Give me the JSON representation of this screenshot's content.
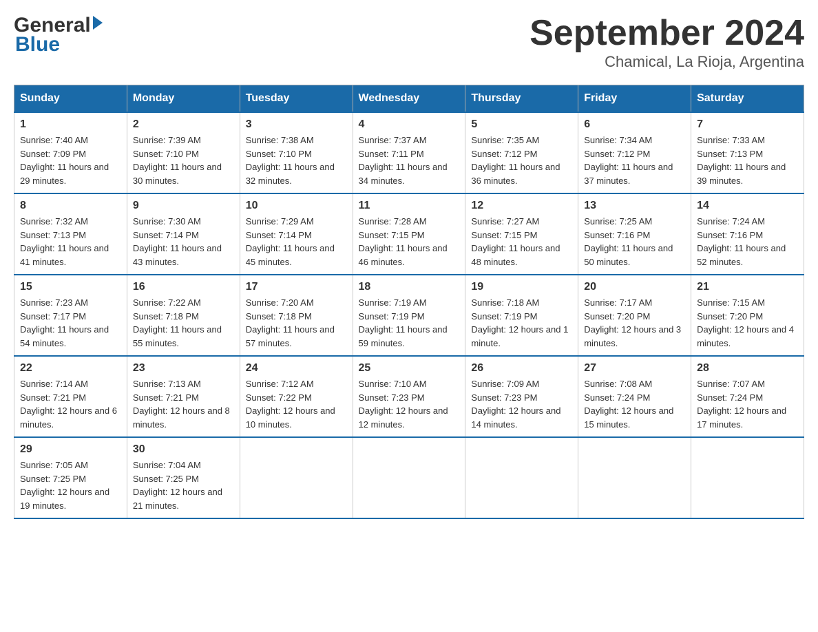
{
  "header": {
    "title": "September 2024",
    "subtitle": "Chamical, La Rioja, Argentina"
  },
  "logo": {
    "general": "General",
    "blue": "Blue"
  },
  "days": [
    "Sunday",
    "Monday",
    "Tuesday",
    "Wednesday",
    "Thursday",
    "Friday",
    "Saturday"
  ],
  "weeks": [
    [
      {
        "date": "1",
        "sunrise": "7:40 AM",
        "sunset": "7:09 PM",
        "daylight": "11 hours and 29 minutes."
      },
      {
        "date": "2",
        "sunrise": "7:39 AM",
        "sunset": "7:10 PM",
        "daylight": "11 hours and 30 minutes."
      },
      {
        "date": "3",
        "sunrise": "7:38 AM",
        "sunset": "7:10 PM",
        "daylight": "11 hours and 32 minutes."
      },
      {
        "date": "4",
        "sunrise": "7:37 AM",
        "sunset": "7:11 PM",
        "daylight": "11 hours and 34 minutes."
      },
      {
        "date": "5",
        "sunrise": "7:35 AM",
        "sunset": "7:12 PM",
        "daylight": "11 hours and 36 minutes."
      },
      {
        "date": "6",
        "sunrise": "7:34 AM",
        "sunset": "7:12 PM",
        "daylight": "11 hours and 37 minutes."
      },
      {
        "date": "7",
        "sunrise": "7:33 AM",
        "sunset": "7:13 PM",
        "daylight": "11 hours and 39 minutes."
      }
    ],
    [
      {
        "date": "8",
        "sunrise": "7:32 AM",
        "sunset": "7:13 PM",
        "daylight": "11 hours and 41 minutes."
      },
      {
        "date": "9",
        "sunrise": "7:30 AM",
        "sunset": "7:14 PM",
        "daylight": "11 hours and 43 minutes."
      },
      {
        "date": "10",
        "sunrise": "7:29 AM",
        "sunset": "7:14 PM",
        "daylight": "11 hours and 45 minutes."
      },
      {
        "date": "11",
        "sunrise": "7:28 AM",
        "sunset": "7:15 PM",
        "daylight": "11 hours and 46 minutes."
      },
      {
        "date": "12",
        "sunrise": "7:27 AM",
        "sunset": "7:15 PM",
        "daylight": "11 hours and 48 minutes."
      },
      {
        "date": "13",
        "sunrise": "7:25 AM",
        "sunset": "7:16 PM",
        "daylight": "11 hours and 50 minutes."
      },
      {
        "date": "14",
        "sunrise": "7:24 AM",
        "sunset": "7:16 PM",
        "daylight": "11 hours and 52 minutes."
      }
    ],
    [
      {
        "date": "15",
        "sunrise": "7:23 AM",
        "sunset": "7:17 PM",
        "daylight": "11 hours and 54 minutes."
      },
      {
        "date": "16",
        "sunrise": "7:22 AM",
        "sunset": "7:18 PM",
        "daylight": "11 hours and 55 minutes."
      },
      {
        "date": "17",
        "sunrise": "7:20 AM",
        "sunset": "7:18 PM",
        "daylight": "11 hours and 57 minutes."
      },
      {
        "date": "18",
        "sunrise": "7:19 AM",
        "sunset": "7:19 PM",
        "daylight": "11 hours and 59 minutes."
      },
      {
        "date": "19",
        "sunrise": "7:18 AM",
        "sunset": "7:19 PM",
        "daylight": "12 hours and 1 minute."
      },
      {
        "date": "20",
        "sunrise": "7:17 AM",
        "sunset": "7:20 PM",
        "daylight": "12 hours and 3 minutes."
      },
      {
        "date": "21",
        "sunrise": "7:15 AM",
        "sunset": "7:20 PM",
        "daylight": "12 hours and 4 minutes."
      }
    ],
    [
      {
        "date": "22",
        "sunrise": "7:14 AM",
        "sunset": "7:21 PM",
        "daylight": "12 hours and 6 minutes."
      },
      {
        "date": "23",
        "sunrise": "7:13 AM",
        "sunset": "7:21 PM",
        "daylight": "12 hours and 8 minutes."
      },
      {
        "date": "24",
        "sunrise": "7:12 AM",
        "sunset": "7:22 PM",
        "daylight": "12 hours and 10 minutes."
      },
      {
        "date": "25",
        "sunrise": "7:10 AM",
        "sunset": "7:23 PM",
        "daylight": "12 hours and 12 minutes."
      },
      {
        "date": "26",
        "sunrise": "7:09 AM",
        "sunset": "7:23 PM",
        "daylight": "12 hours and 14 minutes."
      },
      {
        "date": "27",
        "sunrise": "7:08 AM",
        "sunset": "7:24 PM",
        "daylight": "12 hours and 15 minutes."
      },
      {
        "date": "28",
        "sunrise": "7:07 AM",
        "sunset": "7:24 PM",
        "daylight": "12 hours and 17 minutes."
      }
    ],
    [
      {
        "date": "29",
        "sunrise": "7:05 AM",
        "sunset": "7:25 PM",
        "daylight": "12 hours and 19 minutes."
      },
      {
        "date": "30",
        "sunrise": "7:04 AM",
        "sunset": "7:25 PM",
        "daylight": "12 hours and 21 minutes."
      },
      null,
      null,
      null,
      null,
      null
    ]
  ],
  "labels": {
    "sunrise": "Sunrise:",
    "sunset": "Sunset:",
    "daylight": "Daylight:"
  }
}
